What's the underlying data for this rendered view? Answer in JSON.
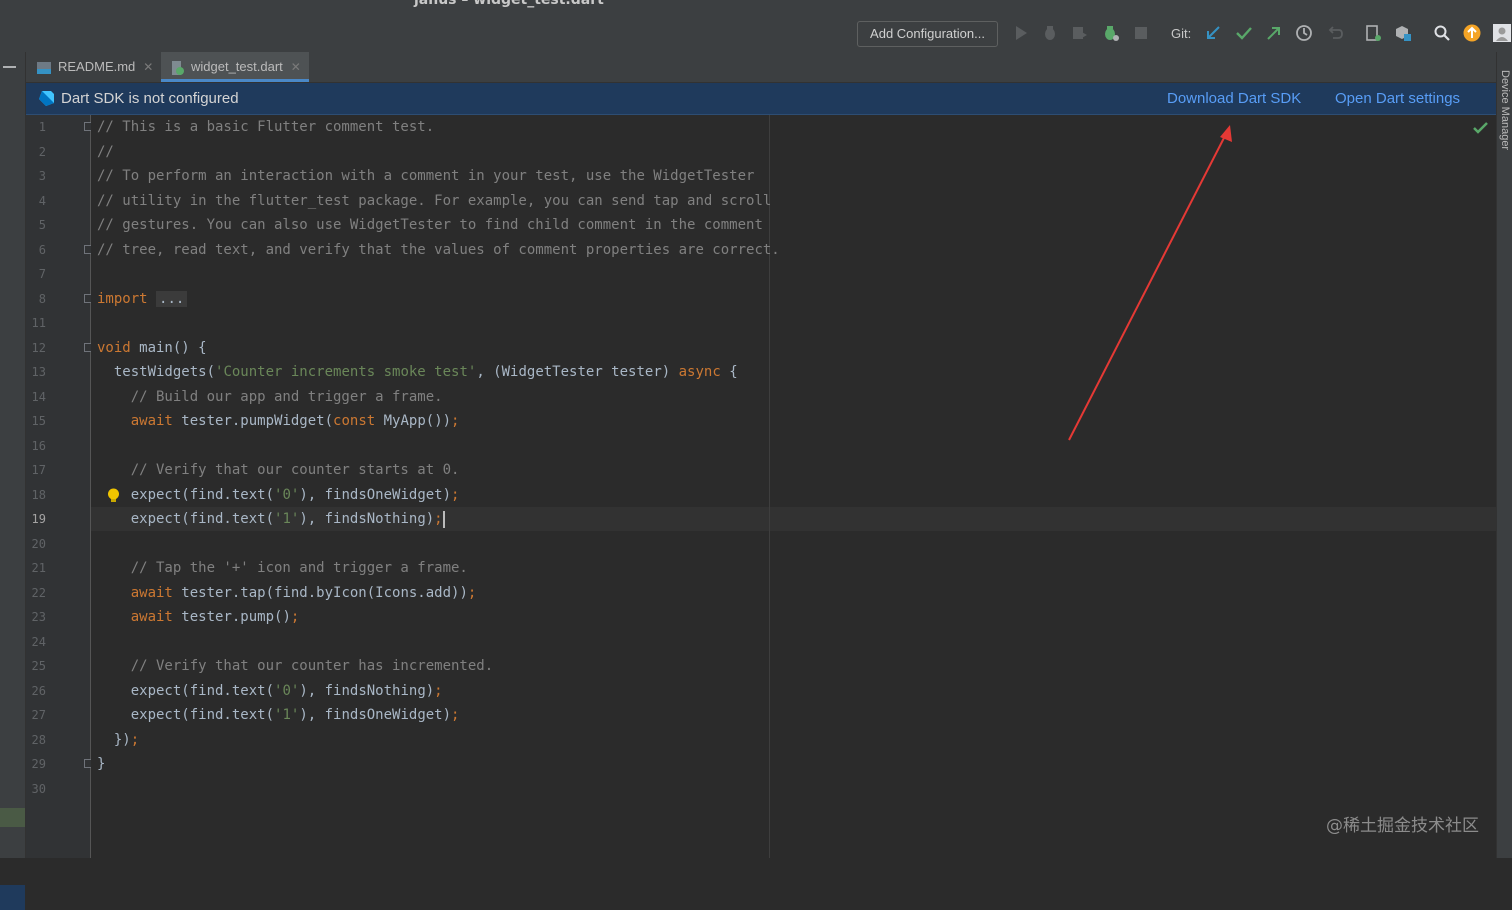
{
  "window": {
    "title": "janus – widget_test.dart"
  },
  "toolbar": {
    "add_configuration": "Add Configuration...",
    "git_label": "Git:",
    "icons": [
      "run-icon",
      "debug-icon",
      "coverage-icon",
      "attach-debugger-icon",
      "stop-icon",
      "git-update-icon",
      "git-commit-icon",
      "git-push-icon",
      "git-history-icon",
      "git-rollback-icon",
      "device-icon",
      "sdk-icon",
      "search-icon",
      "update-icon",
      "avatar-icon"
    ]
  },
  "tabs": [
    {
      "label": "README.md",
      "icon": "markdown-file-icon",
      "active": false
    },
    {
      "label": "widget_test.dart",
      "icon": "dart-test-file-icon",
      "active": true
    }
  ],
  "banner": {
    "message": "Dart SDK is not configured",
    "download_link": "Download Dart SDK",
    "settings_link": "Open Dart settings"
  },
  "side_panel": {
    "device_manager": "Device Manager"
  },
  "editor": {
    "current_line": "19",
    "lines": [
      {
        "num": "1",
        "text": "// This is a basic Flutter comment test."
      },
      {
        "num": "2",
        "text": "//"
      },
      {
        "num": "3",
        "text": "// To perform an interaction with a comment in your test, use the WidgetTester"
      },
      {
        "num": "4",
        "text": "// utility in the flutter_test package. For example, you can send tap and scroll"
      },
      {
        "num": "5",
        "text": "// gestures. You can also use WidgetTester to find child comment in the comment"
      },
      {
        "num": "6",
        "text": "// tree, read text, and verify that the values of comment properties are correct."
      },
      {
        "num": "7",
        "text": ""
      },
      {
        "num": "8",
        "text": "import ..."
      },
      {
        "num": "11",
        "text": ""
      },
      {
        "num": "12",
        "text": "void main() {"
      },
      {
        "num": "13",
        "text": "  testWidgets('Counter increments smoke test', (WidgetTester tester) async {"
      },
      {
        "num": "14",
        "text": "    // Build our app and trigger a frame."
      },
      {
        "num": "15",
        "text": "    await tester.pumpWidget(const MyApp());"
      },
      {
        "num": "16",
        "text": ""
      },
      {
        "num": "17",
        "text": "    // Verify that our counter starts at 0."
      },
      {
        "num": "18",
        "text": "    expect(find.text('0'), findsOneWidget);"
      },
      {
        "num": "19",
        "text": "    expect(find.text('1'), findsNothing);"
      },
      {
        "num": "20",
        "text": ""
      },
      {
        "num": "21",
        "text": "    // Tap the '+' icon and trigger a frame."
      },
      {
        "num": "22",
        "text": "    await tester.tap(find.byIcon(Icons.add));"
      },
      {
        "num": "23",
        "text": "    await tester.pump();"
      },
      {
        "num": "24",
        "text": ""
      },
      {
        "num": "25",
        "text": "    // Verify that our counter has incremented."
      },
      {
        "num": "26",
        "text": "    expect(find.text('0'), findsNothing);"
      },
      {
        "num": "27",
        "text": "    expect(find.text('1'), findsOneWidget);"
      },
      {
        "num": "28",
        "text": "  });"
      },
      {
        "num": "29",
        "text": "}"
      },
      {
        "num": "30",
        "text": ""
      }
    ]
  },
  "watermark": "@稀土掘金技术社区",
  "colors": {
    "banner": "#1f3a5c",
    "link": "#589df6",
    "keyword": "#cc7832",
    "string": "#6a8759",
    "comment": "#808080",
    "annotation_arrow": "#e53935"
  }
}
